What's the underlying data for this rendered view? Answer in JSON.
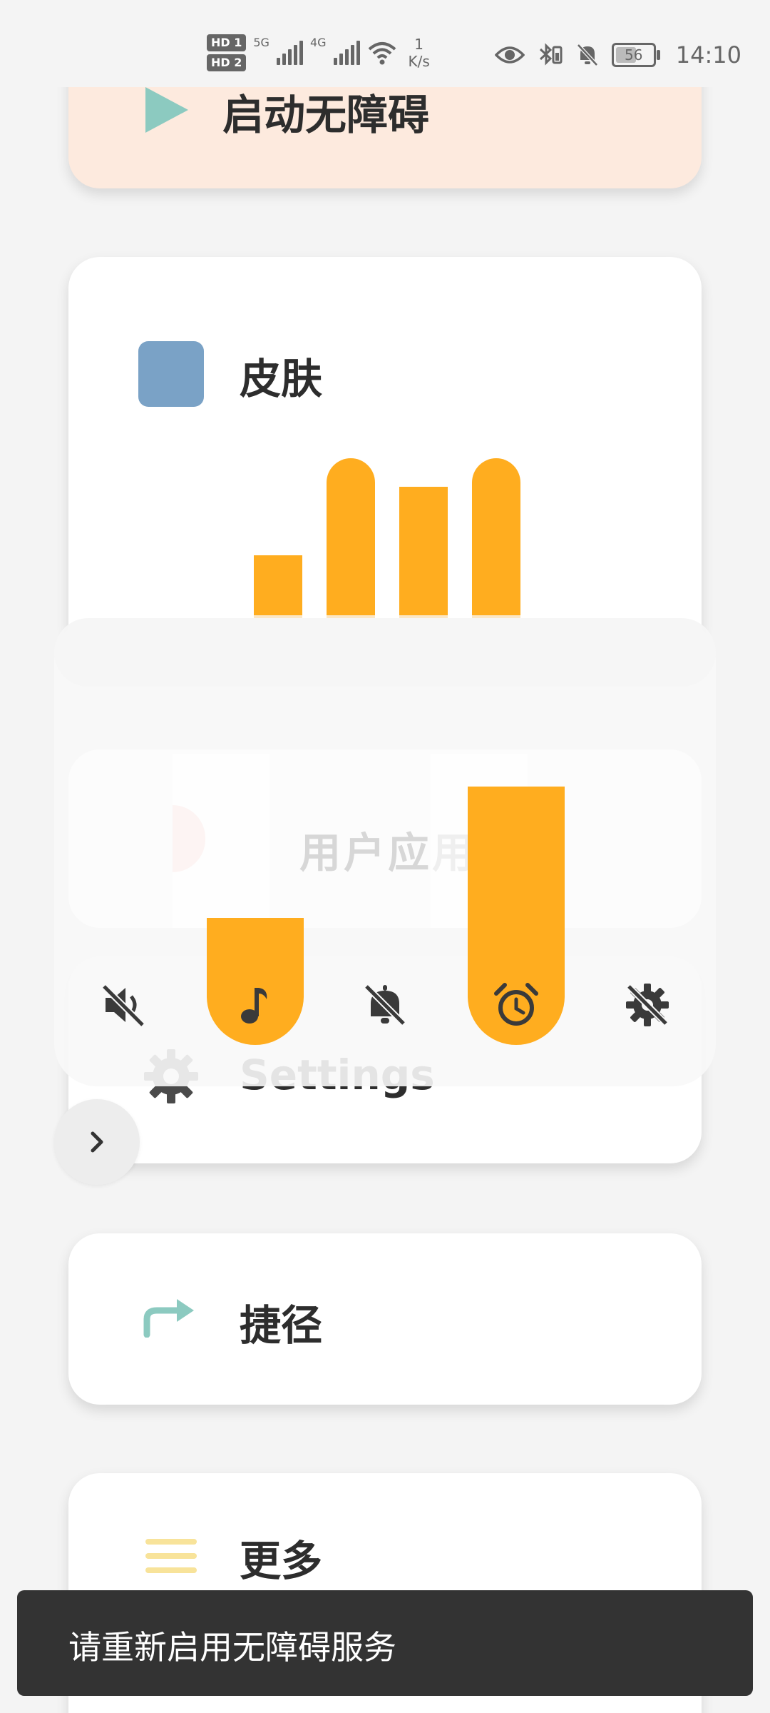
{
  "status_bar": {
    "hd1": "HD 1",
    "hd2": "HD 2",
    "net1": "5G",
    "net2": "4G",
    "speed_value": "1",
    "speed_unit": "K/s",
    "battery": "56",
    "time": "14:10"
  },
  "cards": {
    "start_accessibility": "启动无障碍",
    "skin": "皮肤",
    "settings": "Settings",
    "shortcut": "捷径",
    "more": "更多"
  },
  "overlay": {
    "ghost_text": "用户应用程序",
    "levels": {
      "mute": 0.0,
      "music": 0.35,
      "ring": 0.0,
      "alarm": 1.0,
      "system_off": 0.0
    }
  },
  "toast": {
    "message": "请重新启用无障碍服务"
  },
  "colors": {
    "accent": "#ffad1f",
    "skin_swatch": "#7aa2c6",
    "start_card_bg": "#fdeade",
    "icon_teal": "#8ccac0",
    "toast_bg": "#333333"
  }
}
